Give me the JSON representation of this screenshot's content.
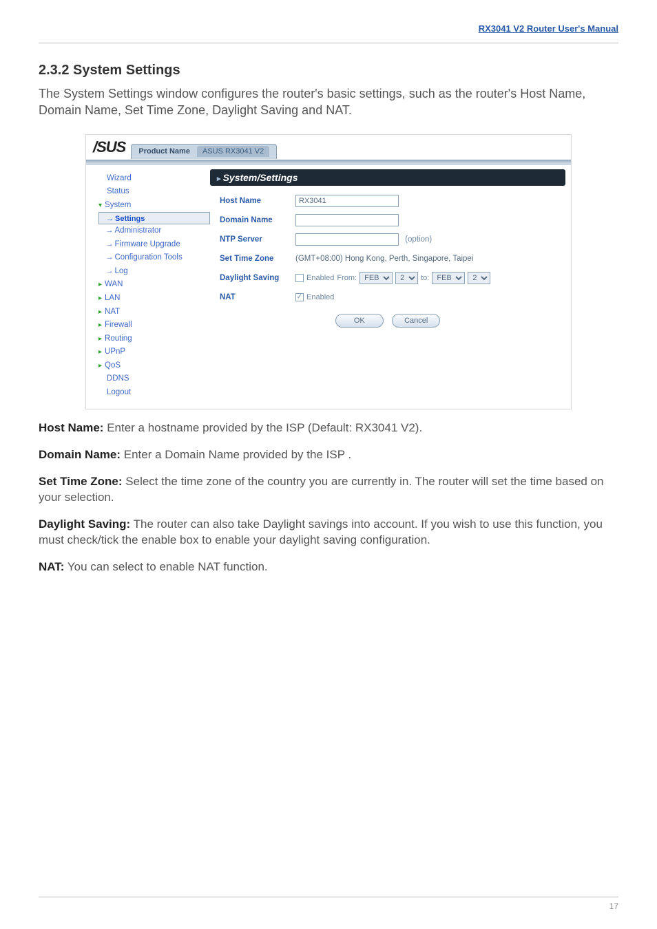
{
  "header_link": "RX3041 V2 Router User's Manual",
  "section_title": "2.3.2 System Settings",
  "intro": "The System Settings window configures the router's basic settings, such as the router's Host Name, Domain Name, Set Time Zone, Daylight Saving and NAT.",
  "screenshot": {
    "logo_text": "/SUS",
    "tab": {
      "product_name_label": "Product Name",
      "product_name_value": "ASUS RX3041 V2"
    },
    "nav": {
      "wizard": "Wizard",
      "status": "Status",
      "system": "System",
      "settings": "Settings",
      "administrator": "Administrator",
      "firmware": "Firmware Upgrade",
      "config_tools": "Configuration Tools",
      "log": "Log",
      "wan": "WAN",
      "lan": "LAN",
      "nat": "NAT",
      "firewall": "Firewall",
      "routing": "Routing",
      "upnp": "UPnP",
      "qos": "QoS",
      "ddns": "DDNS",
      "logout": "Logout"
    },
    "panel_title": "System/Settings",
    "form": {
      "host_name_label": "Host Name",
      "host_name_value": "RX3041",
      "domain_name_label": "Domain Name",
      "domain_name_value": "",
      "ntp_server_label": "NTP Server",
      "ntp_server_value": "",
      "ntp_option_note": "(option)",
      "set_time_zone_label": "Set Time Zone",
      "set_time_zone_value": "(GMT+08:00) Hong Kong, Perth, Singapore, Taipei",
      "daylight_label": "Daylight Saving",
      "daylight_enabled_text": "Enabled",
      "daylight_from_text": "From:",
      "daylight_to_text": "to:",
      "daylight_month1": "FEB",
      "daylight_day1": "2",
      "daylight_month2": "FEB",
      "daylight_day2": "2",
      "nat_label": "NAT",
      "nat_enabled_text": "Enabled",
      "ok": "OK",
      "cancel": "Cancel"
    }
  },
  "paras": {
    "p1_label": "Host Name:",
    "p1_body": " Enter a hostname provided by the ISP (Default: RX3041 V2).",
    "p2_label": "Domain Name:",
    "p2_body": " Enter a Domain Name provided by the ISP .",
    "p3_label": "Set Time Zone:",
    "p3_body": " Select the time zone of the country you are currently in. The router will set the time based on your selection.",
    "p4_label": "Daylight Saving:",
    "p4_body": " The router can also take Daylight savings into account. If you wish to use this function, you must check/tick the enable box to enable your daylight saving configuration.",
    "p5_label": "NAT:",
    "p5_body": " You can select to enable NAT function."
  },
  "page_number": "17"
}
